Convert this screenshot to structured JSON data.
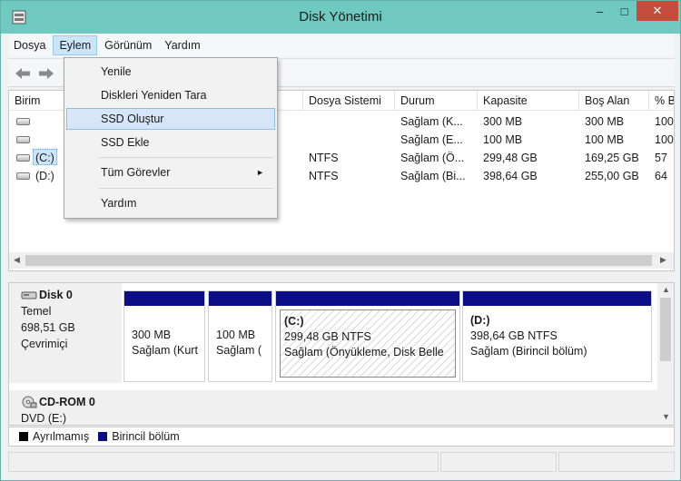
{
  "window": {
    "title": "Disk Yönetimi",
    "controls": {
      "minimize": "–",
      "maximize": "□",
      "close": "✕"
    }
  },
  "menu": {
    "items": [
      "Dosya",
      "Eylem",
      "Görünüm",
      "Yardım"
    ],
    "active": "Eylem"
  },
  "toolbar": {
    "icons": [
      "back-arrow-icon",
      "forward-arrow-icon"
    ]
  },
  "eylem_menu": {
    "items": [
      {
        "label": "Yenile"
      },
      {
        "label": "Diskleri Yeniden Tara"
      },
      {
        "label": "SSD Oluştur",
        "highlighted": true
      },
      {
        "label": "SSD Ekle"
      },
      {
        "label": "Tüm Görevler",
        "submenu_arrow": "►"
      },
      {
        "label": "Yardım"
      }
    ]
  },
  "volume_list": {
    "columns": [
      "Birim",
      "Dosya Sistemi",
      "Durum",
      "Kapasite",
      "Boş Alan",
      "% B"
    ],
    "rows": [
      {
        "volume": "",
        "fs": "",
        "status": "Sağlam (K...",
        "capacity": "300 MB",
        "free": "300 MB",
        "pct": "100"
      },
      {
        "volume": "",
        "fs": "",
        "status": "Sağlam (E...",
        "capacity": "100 MB",
        "free": "100 MB",
        "pct": "100"
      },
      {
        "volume": "(C:)",
        "fs": "NTFS",
        "status": "Sağlam (Ö...",
        "capacity": "299,48 GB",
        "free": "169,25 GB",
        "pct": "57"
      },
      {
        "volume": "(D:)",
        "fs": "NTFS",
        "status": "Sağlam (Bi...",
        "capacity": "398,64 GB",
        "free": "255,00 GB",
        "pct": "64"
      }
    ]
  },
  "disks": [
    {
      "name": "Disk 0",
      "type": "Temel",
      "size": "698,51 GB",
      "state": "Çevrimiçi",
      "partitions": [
        {
          "title": "",
          "size": "300 MB",
          "status": "Sağlam (Kurt"
        },
        {
          "title": "",
          "size": "100 MB",
          "status": "Sağlam ("
        },
        {
          "title": "(C:)",
          "size": "299,48 GB NTFS",
          "status": "Sağlam (Önyükleme, Disk Belle"
        },
        {
          "title": "(D:)",
          "size": "398,64 GB NTFS",
          "status": "Sağlam (Birincil bölüm)"
        }
      ]
    },
    {
      "name": "CD-ROM 0",
      "type": "DVD (E:)"
    }
  ],
  "legend": [
    {
      "label": "Ayrılmamış",
      "color": "#000000"
    },
    {
      "label": "Birincil bölüm",
      "color": "#0a0d86"
    }
  ]
}
